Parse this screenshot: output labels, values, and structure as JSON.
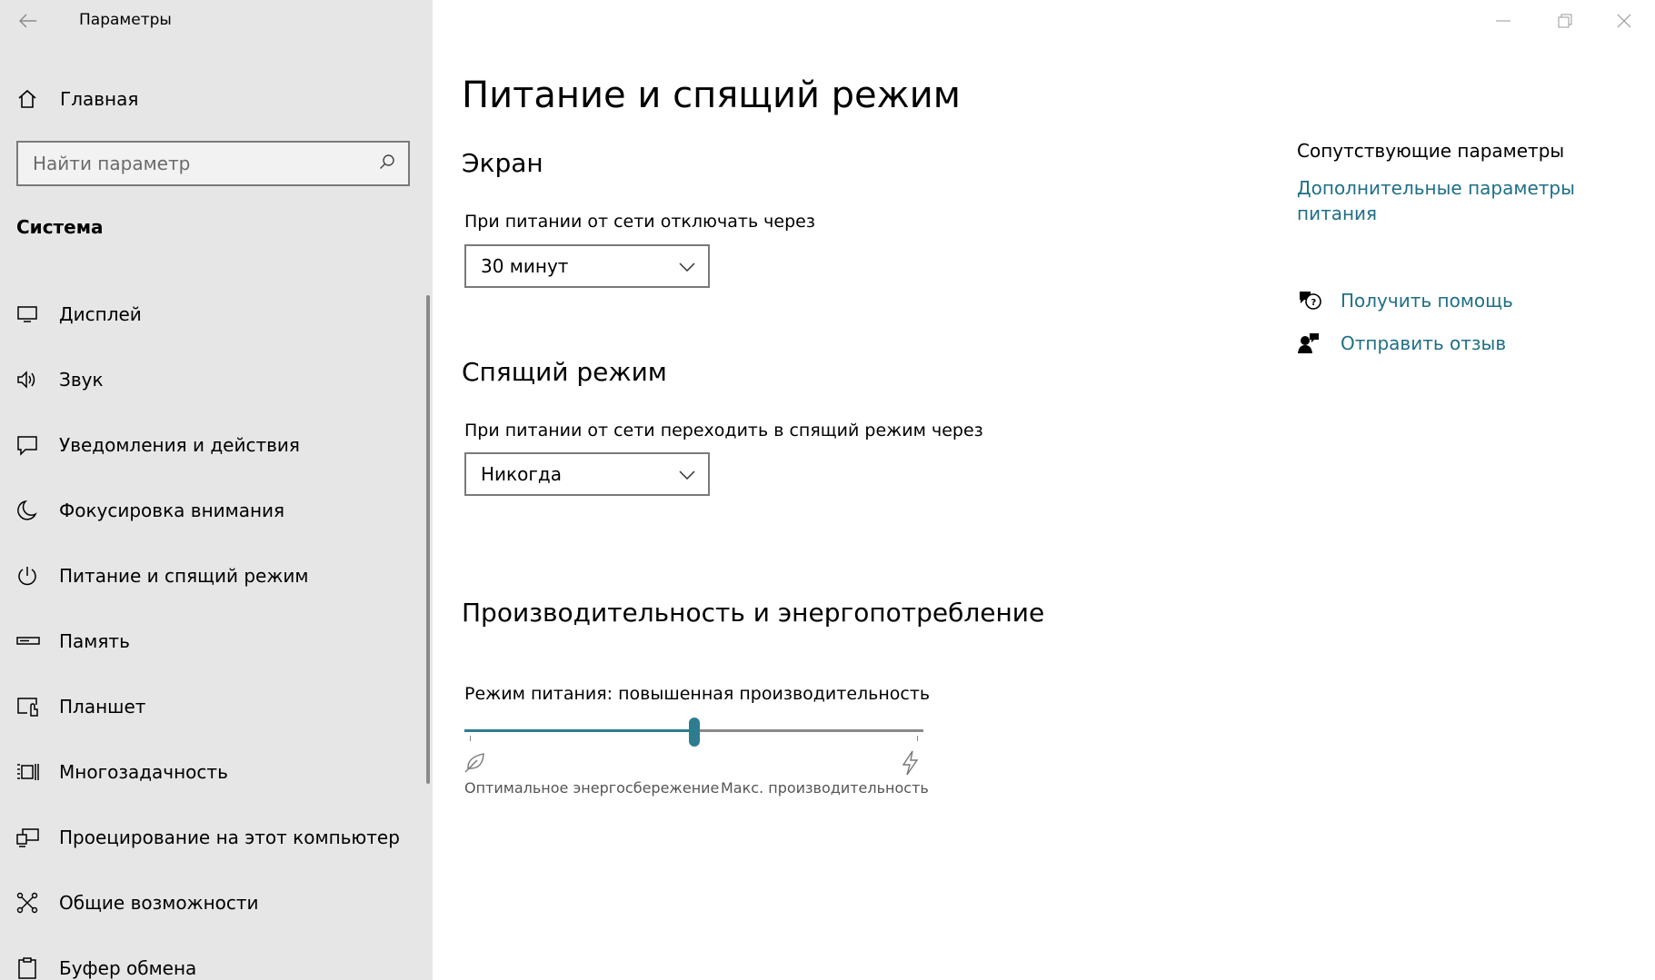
{
  "window": {
    "app_title": "Параметры"
  },
  "sidebar": {
    "home_label": "Главная",
    "search_placeholder": "Найти параметр",
    "section_title": "Система",
    "items": [
      {
        "label": "Дисплей",
        "icon": "display-icon"
      },
      {
        "label": "Звук",
        "icon": "speaker-icon"
      },
      {
        "label": "Уведомления и действия",
        "icon": "notification-icon"
      },
      {
        "label": "Фокусировка внимания",
        "icon": "moon-icon"
      },
      {
        "label": "Питание и спящий режим",
        "icon": "power-icon",
        "selected": true
      },
      {
        "label": "Память",
        "icon": "storage-icon"
      },
      {
        "label": "Планшет",
        "icon": "tablet-icon"
      },
      {
        "label": "Многозадачность",
        "icon": "multitasking-icon"
      },
      {
        "label": "Проецирование на этот компьютер",
        "icon": "projection-icon"
      },
      {
        "label": "Общие возможности",
        "icon": "shared-experiences-icon"
      },
      {
        "label": "Буфер обмена",
        "icon": "clipboard-icon"
      }
    ]
  },
  "main": {
    "title": "Питание и спящий режим",
    "screen": {
      "heading": "Экран",
      "label": "При питании от сети отключать через",
      "value": "30 минут"
    },
    "sleep": {
      "heading": "Спящий режим",
      "label": "При питании от сети переходить в спящий режим через",
      "value": "Никогда"
    },
    "performance": {
      "heading": "Производительность и энергопотребление",
      "label": "Режим питания: повышенная производительность",
      "slider_value": 0.5,
      "left_caption": "Оптимальное энергосбережение",
      "right_caption": "Макс. производительность"
    }
  },
  "related": {
    "title": "Сопутствующие параметры",
    "additional_power_link": "Дополнительные параметры питания",
    "get_help": "Получить помощь",
    "send_feedback": "Отправить отзыв"
  },
  "colors": {
    "accent": "#2d7d8f",
    "link": "#1f6f86",
    "sidebar_bg": "#e6e6e6"
  }
}
